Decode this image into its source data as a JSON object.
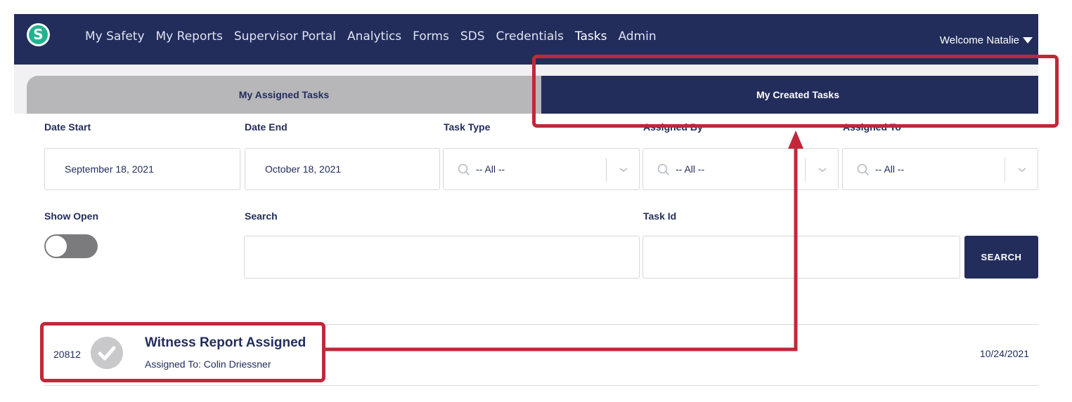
{
  "nav": {
    "logo_letter": "S",
    "links": [
      "My Safety",
      "My Reports",
      "Supervisor Portal",
      "Analytics",
      "Forms",
      "SDS",
      "Credentials",
      "Tasks",
      "Admin"
    ],
    "active": "Tasks",
    "welcome": "Welcome Natalie"
  },
  "tabs": {
    "assigned": "My Assigned Tasks",
    "created": "My Created Tasks",
    "active": "My Created Tasks"
  },
  "filters": {
    "date_start_label": "Date Start",
    "date_start_value": "September 18, 2021",
    "date_end_label": "Date End",
    "date_end_value": "October 18, 2021",
    "task_type_label": "Task Type",
    "task_type_value": "-- All --",
    "assigned_by_label": "Assigned By",
    "assigned_by_value": "-- All --",
    "assigned_to_label": "Assigned To",
    "assigned_to_value": "-- All --",
    "show_open_label": "Show Open",
    "show_open_on": false,
    "search_label": "Search",
    "search_value": "",
    "task_id_label": "Task Id",
    "task_id_value": "",
    "search_button": "SEARCH"
  },
  "tasks": [
    {
      "id": "20812",
      "title": "Witness Report Assigned",
      "subtitle": "Assigned To: Colin Driessner",
      "date": "10/24/2021"
    }
  ],
  "colors": {
    "navy": "#232d5c",
    "accent_green": "#20b38f",
    "annotation_red": "#c0283a",
    "tab_inactive": "#b7b7b9"
  }
}
